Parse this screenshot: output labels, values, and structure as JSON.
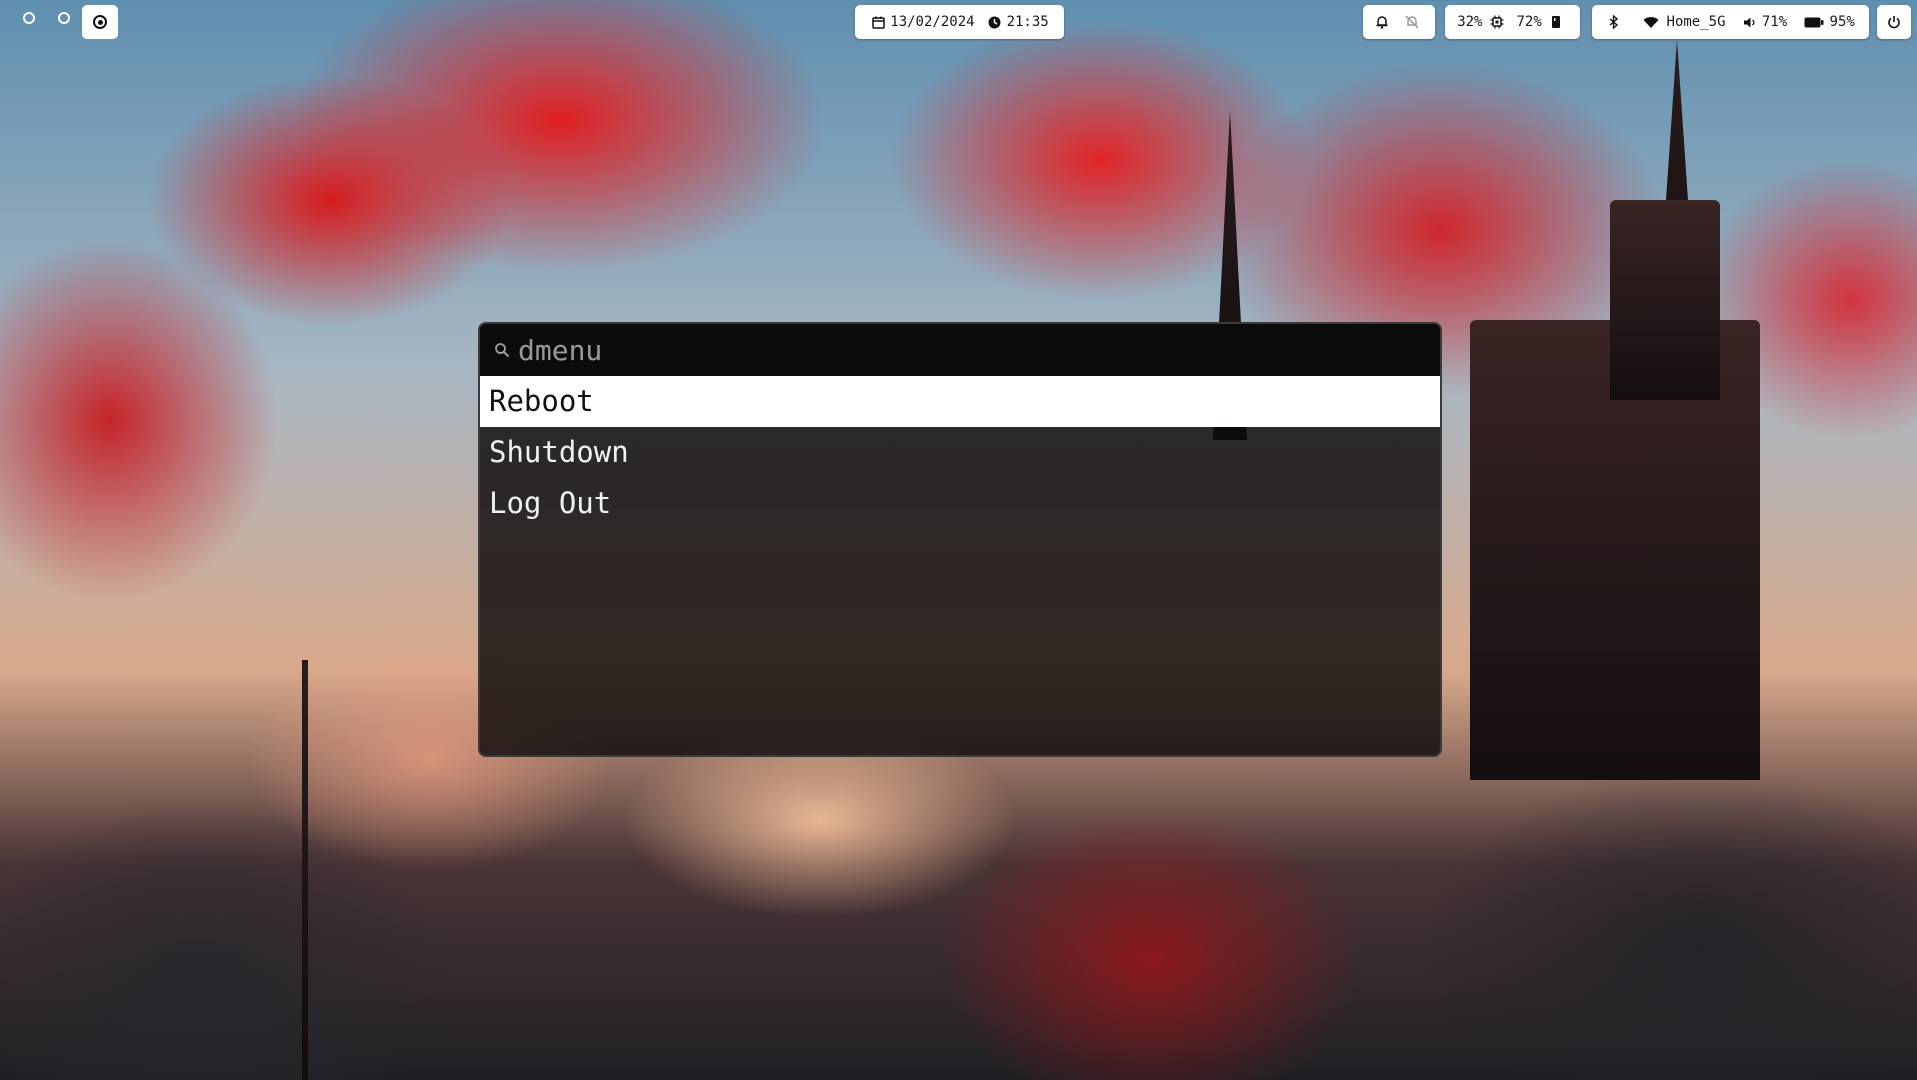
{
  "workspaces": [
    {
      "name": "workspace-1",
      "active": false
    },
    {
      "name": "workspace-2",
      "active": false
    },
    {
      "name": "workspace-3",
      "active": true
    }
  ],
  "clock": {
    "date": "13/02/2024",
    "time": "21:35",
    "date_icon": "calendar-icon",
    "time_icon": "clock-icon"
  },
  "tray": {
    "icons": [
      "notification-icon",
      "do-not-disturb-icon"
    ]
  },
  "system": {
    "cpu": "32%",
    "cpu_icon": "cpu-icon",
    "memory": "72%",
    "memory_icon": "memory-icon"
  },
  "status": {
    "bluetooth_icon": "bluetooth-icon",
    "wifi_icon": "wifi-icon",
    "network": "Home_5G",
    "volume_icon": "volume-icon",
    "volume": "71%",
    "battery_icon": "battery-icon",
    "battery": "95%"
  },
  "power": {
    "icon": "power-icon"
  },
  "launcher": {
    "placeholder": "dmenu",
    "query": "",
    "search_icon": "search-icon",
    "entries": [
      {
        "label": "Reboot",
        "selected": true
      },
      {
        "label": "Shutdown",
        "selected": false
      },
      {
        "label": "Log Out",
        "selected": false
      }
    ]
  },
  "colors": {
    "bar_bg": "#ffffff",
    "launcher_bg": "#0e0a0b",
    "selected_bg": "#ffffff",
    "accent_red": "#d81b1f"
  }
}
